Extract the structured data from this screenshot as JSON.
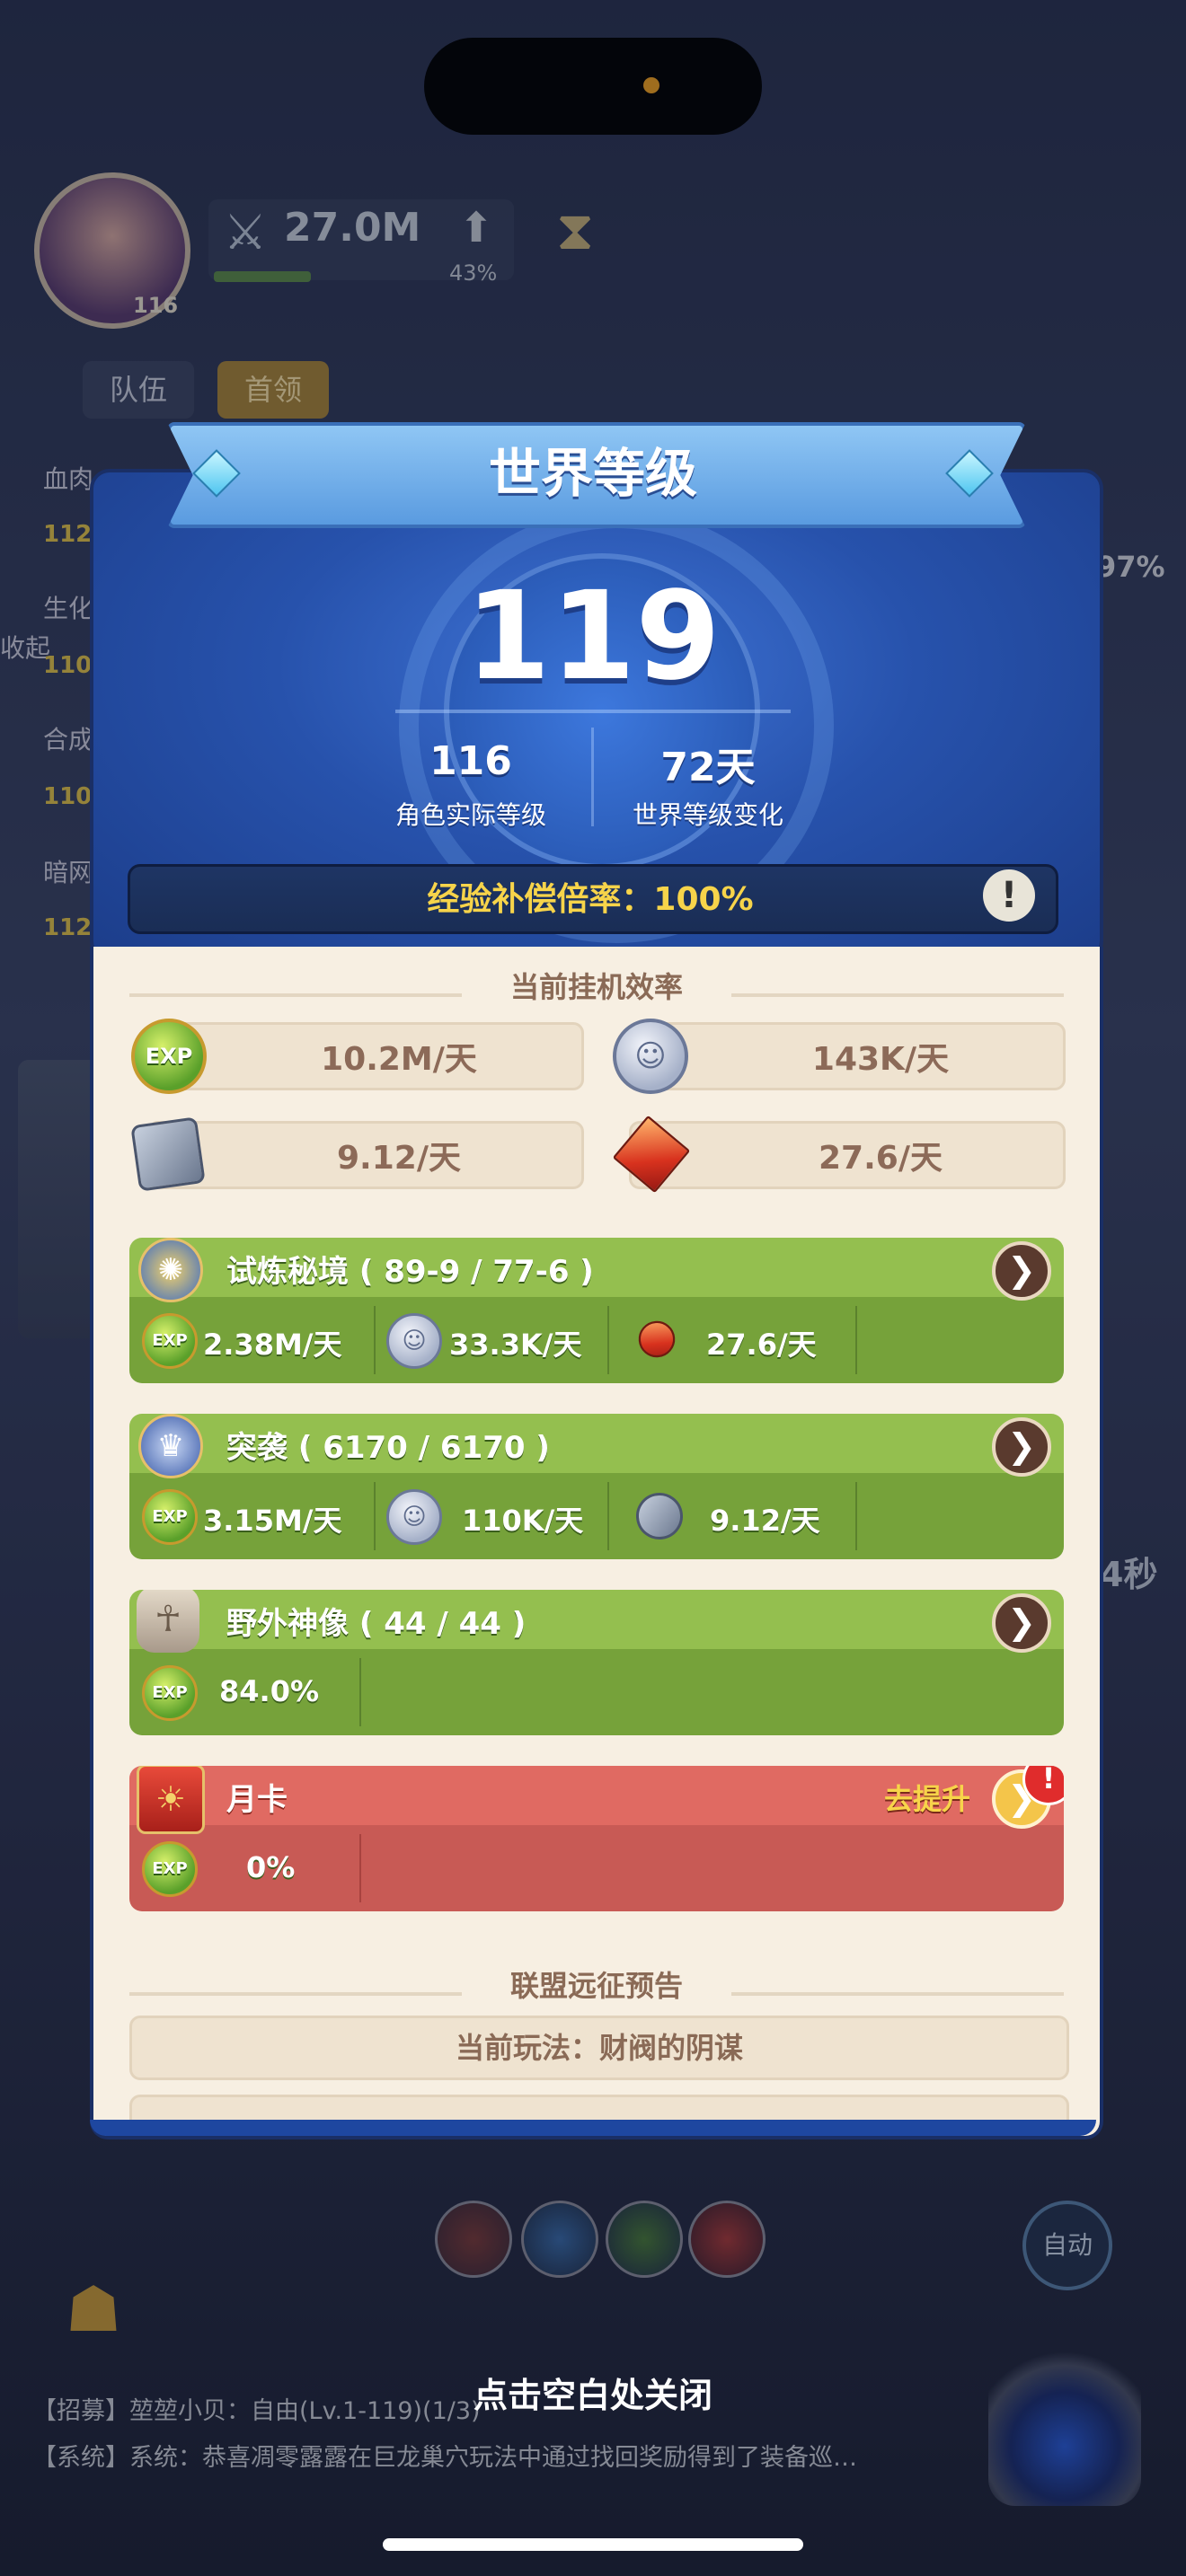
{
  "hud": {
    "player_level": "116",
    "power": "27.0M",
    "power_growth": "43%",
    "tabs": [
      "队伍",
      "首领"
    ],
    "side_labels": [
      "血肉",
      "生化",
      "合成",
      "暗网"
    ],
    "side_values": [
      "112",
      "110",
      "110",
      "112"
    ],
    "collapse_label": "收起",
    "right_pct": "97%",
    "right_seconds": "4秒",
    "auto_label": "自动",
    "close_hint": "点击空白处关闭",
    "chat_lines": [
      "【招募】堃堃小贝：自由(Lv.1-119)(1/3)",
      "【系统】系统：恭喜凋零露露在巨龙巢穴玩法中通过找回奖励得到了装备巡…"
    ]
  },
  "dialog": {
    "title": "世界等级",
    "world_level": "119",
    "actual_level_value": "116",
    "actual_level_label": "角色实际等级",
    "change_value": "72天",
    "change_label": "世界等级变化",
    "compensation": "经验补偿倍率：100%",
    "warn_icon": "!",
    "efficiency": {
      "title": "当前挂机效率",
      "exp": "10.2M/天",
      "coin": "143K/天",
      "stone": "9.12/天",
      "crystal": "27.6/天"
    },
    "cards": [
      {
        "title": "试炼秘境 ( 89-9 / 77-6 )",
        "exp": "2.38M/天",
        "coin": "33.3K/天",
        "third": "27.6/天"
      },
      {
        "title": "突袭 ( 6170 / 6170 )",
        "exp": "3.15M/天",
        "coin": "110K/天",
        "third": "9.12/天"
      },
      {
        "title": "野外神像 ( 44 / 44 )",
        "exp": "84.0%"
      },
      {
        "title": "月卡",
        "upgrade": "去提升",
        "exp": "0%",
        "badge": "!"
      }
    ],
    "alliance": {
      "title": "联盟远征预告",
      "current": "当前玩法：财阀的阴谋"
    }
  },
  "icons": {
    "exp_text": "EXP",
    "chevron": "❯"
  },
  "colors": {
    "green_head": "#94bf4f",
    "green_body": "#76a23a",
    "red_head": "#e06a62",
    "red_body": "#c85a55"
  }
}
